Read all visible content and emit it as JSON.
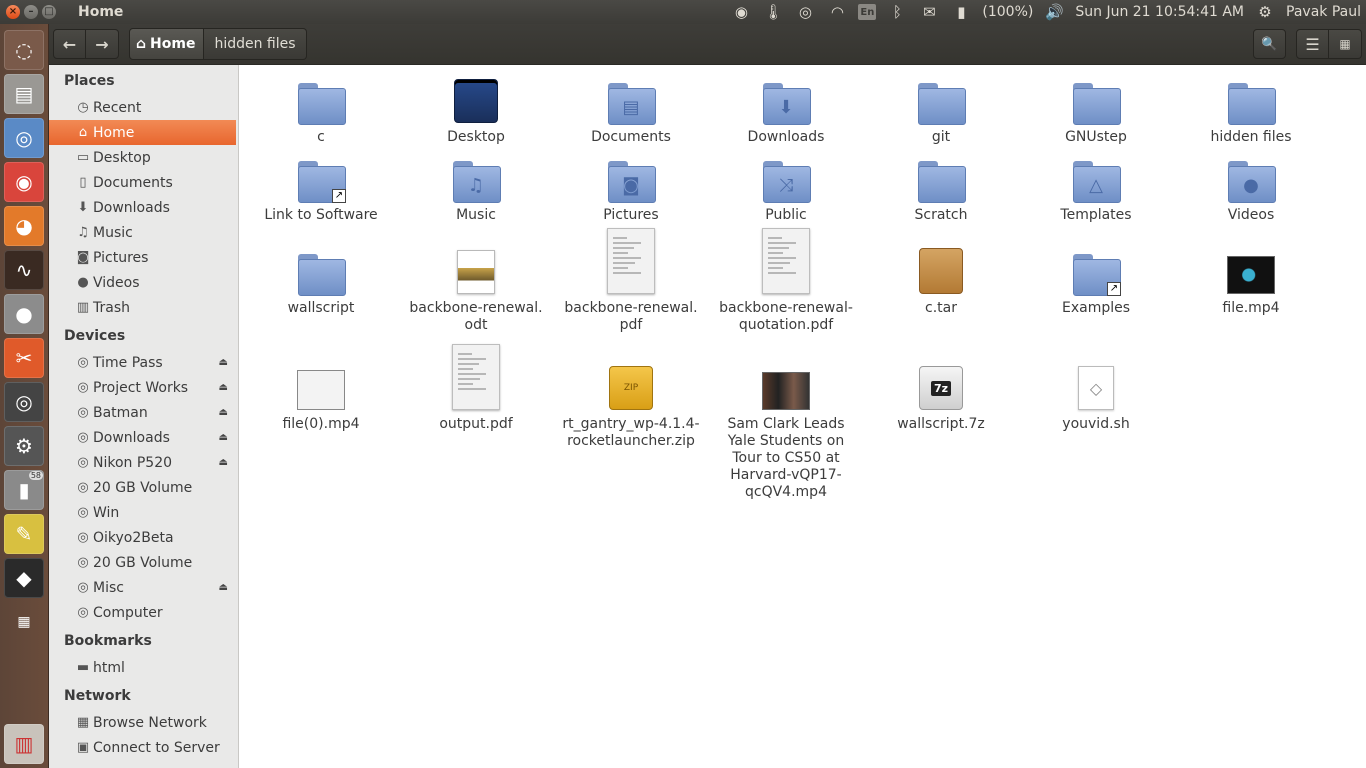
{
  "window": {
    "title": "Home"
  },
  "tray": {
    "keyboard": "En",
    "battery": "(100%)",
    "clock": "Sun Jun 21 10:54:41 AM",
    "user": "Pavak Paul"
  },
  "launcher": {
    "badge": "58"
  },
  "toolbar": {
    "back": "←",
    "forward": "→",
    "path": [
      "Home",
      "hidden files"
    ],
    "search_icon": "🔍",
    "menu_icon": "☰",
    "view_icon": "▦"
  },
  "sidebar": {
    "places_title": "Places",
    "places": [
      {
        "label": "Recent",
        "icon": "clock-icon",
        "glyph": "◷"
      },
      {
        "label": "Home",
        "icon": "home-icon",
        "glyph": "⌂"
      },
      {
        "label": "Desktop",
        "icon": "desktop-icon",
        "glyph": "▭"
      },
      {
        "label": "Documents",
        "icon": "document-icon",
        "glyph": "▯"
      },
      {
        "label": "Downloads",
        "icon": "download-icon",
        "glyph": "⬇"
      },
      {
        "label": "Music",
        "icon": "music-icon",
        "glyph": "♫"
      },
      {
        "label": "Pictures",
        "icon": "camera-icon",
        "glyph": "◙"
      },
      {
        "label": "Videos",
        "icon": "video-icon",
        "glyph": "●"
      },
      {
        "label": "Trash",
        "icon": "trash-icon",
        "glyph": "▥"
      }
    ],
    "devices_title": "Devices",
    "devices": [
      {
        "label": "Time Pass"
      },
      {
        "label": "Project Works"
      },
      {
        "label": "Batman"
      },
      {
        "label": "Downloads"
      },
      {
        "label": "Nikon P520"
      },
      {
        "label": "20 GB Volume"
      },
      {
        "label": "Win"
      },
      {
        "label": "Oikyo2Beta"
      },
      {
        "label": "20 GB Volume"
      },
      {
        "label": "Misc"
      },
      {
        "label": "Computer"
      }
    ],
    "bookmarks_title": "Bookmarks",
    "bookmarks": [
      {
        "label": "html"
      }
    ],
    "network_title": "Network",
    "network": [
      {
        "label": "Browse Network"
      },
      {
        "label": "Connect to Server"
      }
    ]
  },
  "files": [
    {
      "name": "c",
      "type": "folder"
    },
    {
      "name": "Desktop",
      "type": "desktop-folder"
    },
    {
      "name": "Documents",
      "type": "folder"
    },
    {
      "name": "Downloads",
      "type": "folder"
    },
    {
      "name": "git",
      "type": "folder"
    },
    {
      "name": "GNUstep",
      "type": "folder"
    },
    {
      "name": "hidden files",
      "type": "folder"
    },
    {
      "name": "Link to Software",
      "type": "folder-link"
    },
    {
      "name": "Music",
      "type": "folder"
    },
    {
      "name": "Pictures",
      "type": "folder"
    },
    {
      "name": "Public",
      "type": "folder"
    },
    {
      "name": "Scratch",
      "type": "folder"
    },
    {
      "name": "Templates",
      "type": "folder"
    },
    {
      "name": "Videos",
      "type": "folder"
    },
    {
      "name": "wallscript",
      "type": "folder"
    },
    {
      "name": "backbone-renewal.\nodt",
      "type": "odt"
    },
    {
      "name": "backbone-renewal.\npdf",
      "type": "pdf"
    },
    {
      "name": "backbone-renewal-\nquotation.pdf",
      "type": "pdf"
    },
    {
      "name": "c.tar",
      "type": "tar"
    },
    {
      "name": "Examples",
      "type": "folder-link"
    },
    {
      "name": "file.mp4",
      "type": "video"
    },
    {
      "name": "file(0).mp4",
      "type": "video"
    },
    {
      "name": "output.pdf",
      "type": "pdf"
    },
    {
      "name": "rt_gantry_wp-4.1.4-\nrocketlauncher.zip",
      "type": "zip"
    },
    {
      "name": "Sam Clark Leads\nYale Students on\nTour to CS50 at\nHarvard-vQP17-\nqcQV4.mp4",
      "type": "video"
    },
    {
      "name": "wallscript.7z",
      "type": "7z"
    },
    {
      "name": "youvid.sh",
      "type": "sh"
    }
  ]
}
